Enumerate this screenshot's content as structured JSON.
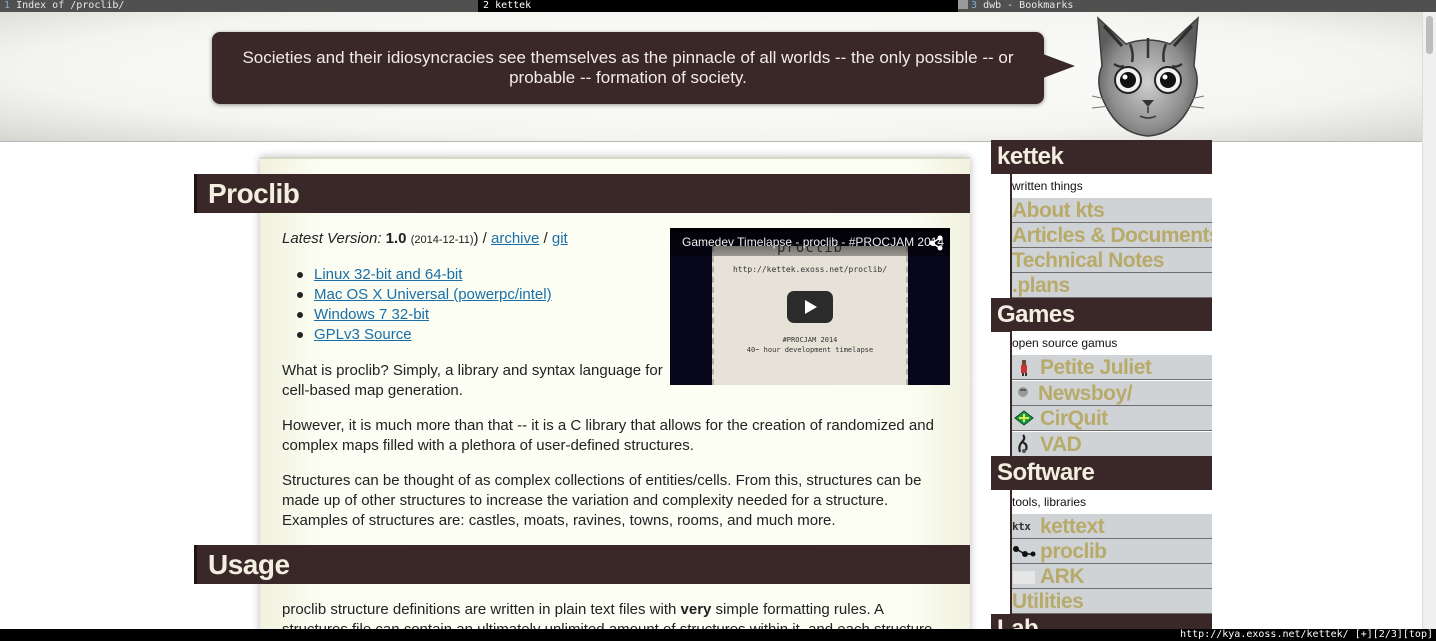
{
  "tabs": [
    {
      "number": "1",
      "title": "Index of /proclib/"
    },
    {
      "number": "2",
      "title": "kettek"
    },
    {
      "number": "3",
      "title": "dwb - Bookmarks"
    }
  ],
  "header": {
    "quote": "Societies and their idiosyncracies see themselves as the pinnacle of all worlds -- the only possible -- or probable -- formation of society."
  },
  "main": {
    "section_title": "Proclib",
    "version_label": "Latest Version:",
    "version": "1.0",
    "version_date": "(2014-12-11)",
    "separator_1": ") / ",
    "archive_link": "archive",
    "separator_2": " / ",
    "git_link": "git",
    "downloads": [
      "Linux 32-bit and 64-bit",
      "Mac OS X Universal (powerpc/intel)",
      "Windows 7 32-bit",
      "GPLv3 Source"
    ],
    "paragraphs": [
      "What is proclib? Simply, a library and syntax language for cell-based map generation.",
      "However, it is much more than that -- it is a C library that allows for the creation of randomized and complex maps filled with a plethora of user-defined structures.",
      "Structures can be thought of as complex collections of entities/cells. From this, structures can be made up of other structures to increase the variation and complexity needed for a structure. Examples of structures are: castles, moats, ravines, towns, rooms, and much more."
    ],
    "usage_title": "Usage",
    "usage_text_before": "proclib structure definitions are written in plain text files with ",
    "usage_text_bold": "very",
    "usage_text_after": " simple formatting rules. A structures file can contain an ultimately unlimited amount of structures within it, and each structure"
  },
  "video": {
    "title": "Gamedev Timelapse - proclib - #PROCJAM 2014",
    "frame_title": "proclib",
    "frame_url": "http://kettek.exoss.net/proclib/",
    "frame_jam": "#PROCJAM 2014",
    "frame_caption": "40~ hour development timelapse"
  },
  "sidebar": {
    "kettek": {
      "title": "kettek",
      "desc": "written things",
      "items": [
        "About kts",
        "Articles & Documents",
        "Technical Notes",
        ".plans"
      ]
    },
    "games": {
      "title": "Games",
      "desc": "open source gamus",
      "items": [
        "Petite Juliet",
        "Newsboy/",
        "CirQuit",
        "VAD"
      ]
    },
    "software": {
      "title": "Software",
      "desc": "tools, libraries",
      "items": [
        "kettext",
        "proclib",
        "ARK",
        "Utilities"
      ]
    },
    "lab": {
      "title": "Lab"
    }
  },
  "statusbar": {
    "url": "http://kya.exoss.net/kettek/",
    "state": "[+][2/3][top]"
  }
}
